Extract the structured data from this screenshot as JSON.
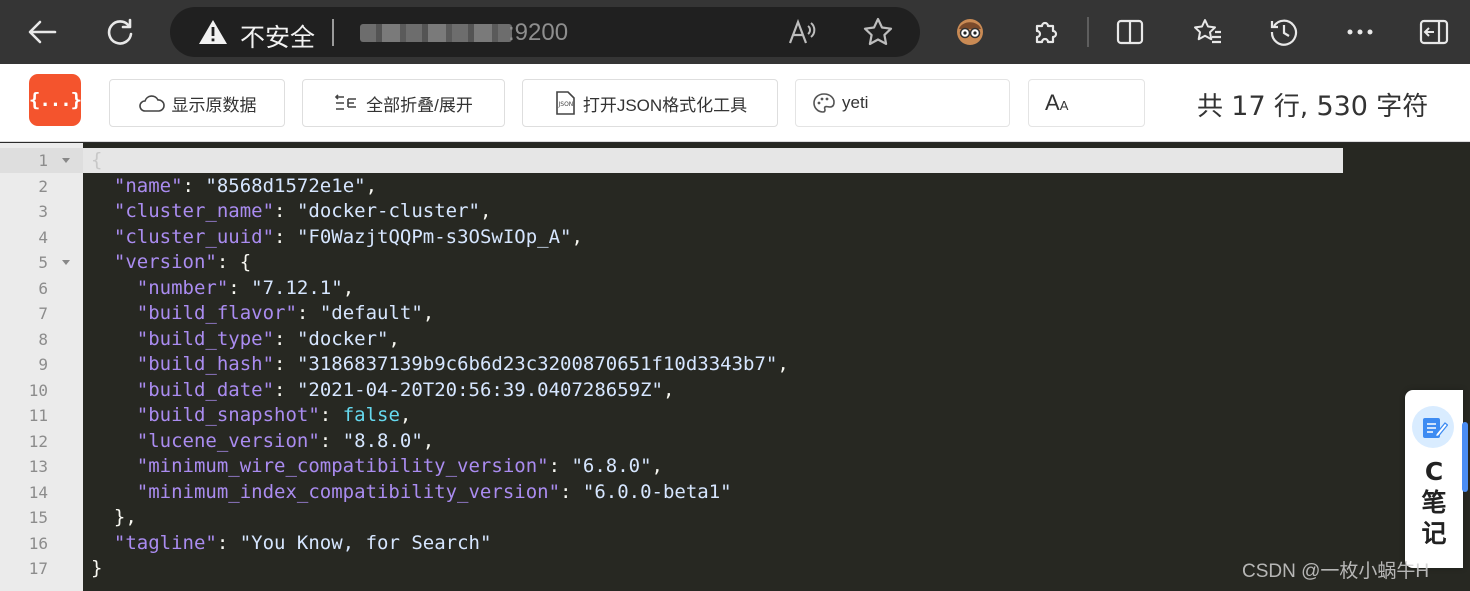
{
  "browser": {
    "security_label": "不安全",
    "url_port": ":9200"
  },
  "viewer": {
    "logo_text": "{...}",
    "buttons": [
      {
        "label": "显示原数据"
      },
      {
        "label": "全部折叠/展开"
      },
      {
        "label": "打开JSON格式化工具"
      },
      {
        "label": "yeti"
      },
      {
        "label": "A"
      }
    ],
    "stats": {
      "prefix": "共",
      "lines": "17",
      "lines_unit": "行,",
      "chars": "530",
      "chars_unit": "字符"
    }
  },
  "code": {
    "line_numbers": [
      "1",
      "2",
      "3",
      "4",
      "5",
      "6",
      "7",
      "8",
      "9",
      "10",
      "11",
      "12",
      "13",
      "14",
      "15",
      "16",
      "17"
    ],
    "lines": [
      {
        "indent": "",
        "open": "{"
      },
      {
        "indent": "  ",
        "key": "\"name\"",
        "sep": ": ",
        "val": "\"8568d1572e1e\"",
        "end": ","
      },
      {
        "indent": "  ",
        "key": "\"cluster_name\"",
        "sep": ": ",
        "val": "\"docker-cluster\"",
        "end": ","
      },
      {
        "indent": "  ",
        "key": "\"cluster_uuid\"",
        "sep": ": ",
        "val": "\"F0WazjtQQPm-s3OSwIOp_A\"",
        "end": ","
      },
      {
        "indent": "  ",
        "key": "\"version\"",
        "sep": ": ",
        "val": "{",
        "end": ""
      },
      {
        "indent": "    ",
        "key": "\"number\"",
        "sep": ": ",
        "val": "\"7.12.1\"",
        "end": ","
      },
      {
        "indent": "    ",
        "key": "\"build_flavor\"",
        "sep": ": ",
        "val": "\"default\"",
        "end": ","
      },
      {
        "indent": "    ",
        "key": "\"build_type\"",
        "sep": ": ",
        "val": "\"docker\"",
        "end": ","
      },
      {
        "indent": "    ",
        "key": "\"build_hash\"",
        "sep": ": ",
        "val": "\"3186837139b9c6b6d23c3200870651f10d3343b7\"",
        "end": ","
      },
      {
        "indent": "    ",
        "key": "\"build_date\"",
        "sep": ": ",
        "val": "\"2021-04-20T20:56:39.040728659Z\"",
        "end": ","
      },
      {
        "indent": "    ",
        "key": "\"build_snapshot\"",
        "sep": ": ",
        "val": "false",
        "end": ","
      },
      {
        "indent": "    ",
        "key": "\"lucene_version\"",
        "sep": ": ",
        "val": "\"8.8.0\"",
        "end": ","
      },
      {
        "indent": "    ",
        "key": "\"minimum_wire_compatibility_version\"",
        "sep": ": ",
        "val": "\"6.8.0\"",
        "end": ","
      },
      {
        "indent": "    ",
        "key": "\"minimum_index_compatibility_version\"",
        "sep": ": ",
        "val": "\"6.0.0-beta1\"",
        "end": ""
      },
      {
        "indent": "  ",
        "close": "},"
      },
      {
        "indent": "  ",
        "key": "\"tagline\"",
        "sep": ": ",
        "val": "\"You Know, for Search\"",
        "end": ""
      },
      {
        "indent": "",
        "close": "}"
      }
    ]
  },
  "note_widget": {
    "letter": "C",
    "line1": "笔",
    "line2": "记"
  },
  "watermark": "CSDN @一枚小蜗牛H",
  "colors": {
    "key": "#aa8cf0",
    "string": "#d6e6ff",
    "bool": "#66d9ef",
    "editor_bg": "#272822",
    "logo": "#f4542d"
  }
}
